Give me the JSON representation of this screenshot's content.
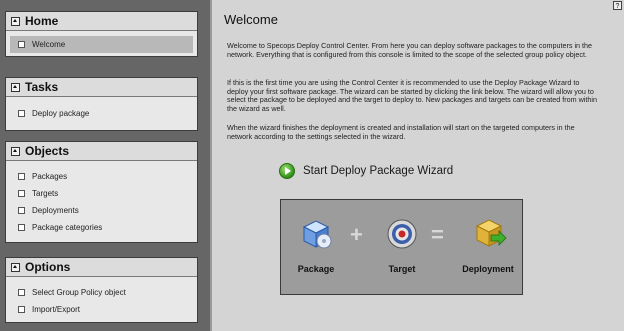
{
  "sidebar": {
    "panels": [
      {
        "title": "Home",
        "items": [
          {
            "label": "Welcome",
            "selected": true
          }
        ]
      },
      {
        "title": "Tasks",
        "items": [
          {
            "label": "Deploy package"
          }
        ]
      },
      {
        "title": "Objects",
        "items": [
          {
            "label": "Packages"
          },
          {
            "label": "Targets"
          },
          {
            "label": "Deployments"
          },
          {
            "label": "Package categories"
          }
        ]
      },
      {
        "title": "Options",
        "items": [
          {
            "label": "Select Group Policy object"
          },
          {
            "label": "Import/Export"
          }
        ]
      }
    ]
  },
  "main": {
    "close_glyph": "?",
    "title": "Welcome",
    "paragraphs": [
      "Welcome to Specops Deploy Control Center. From here you can deploy software packages to the computers in the network. Everything that is configured from this console is limited to the scope of the selected group policy object.",
      "If this is the first time you are using the Control Center it is recommended to use the Deploy Package Wizard to deploy your first software package. The wizard can be started by clicking the link below. The wizard will allow you to select the package to be deployed and the target to deploy to. New packages and targets can be created from within the wizard as well.",
      "When the wizard finishes the deployment is created and installation will start on the targeted computers in the network according to the settings selected in the wizard."
    ],
    "wizard_link": "Start Deploy Package Wizard",
    "diagram": {
      "package": "Package",
      "plus": "+",
      "target": "Target",
      "equals": "=",
      "deployment": "Deployment"
    }
  },
  "colors": {
    "sidebar_bg": "#666666",
    "panel_bg": "#e8e8e8",
    "main_bg": "#d4d4d4",
    "diagram_bg": "#9c9c9c",
    "go_green": "#2f8f16"
  },
  "icons": {
    "collapse": "collapse-up-icon",
    "go": "go-arrow-icon",
    "package": "package-box-icon",
    "target": "target-icon",
    "deployment": "deployment-icon"
  }
}
